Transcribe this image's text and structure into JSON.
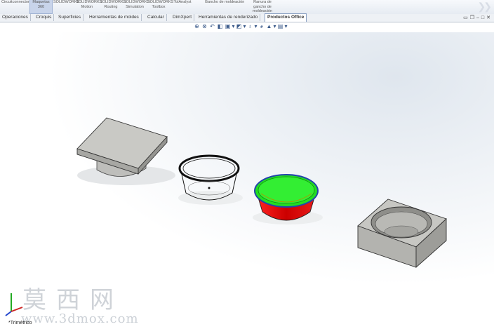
{
  "ribbon": {
    "buttons": [
      {
        "label": "Circuitconnectors"
      },
      {
        "label": "Maquetas\n360"
      },
      {
        "label": "SOLIDWORKS"
      },
      {
        "label": "SOLIDWORKS\nMotion"
      },
      {
        "label": "SOLIDWORKS\nRouting"
      },
      {
        "label": "SOLIDWORKS\nSimulation"
      },
      {
        "label": "SOLIDWORKS\nToolbox"
      },
      {
        "label": "TolAnalyst"
      },
      {
        "label": "Gancho de moldeación"
      },
      {
        "label": "Ranura de\ngancho de\nmoldeación"
      }
    ]
  },
  "tabs": [
    {
      "label": "Operaciones"
    },
    {
      "label": "Croquis"
    },
    {
      "label": "Superficies"
    },
    {
      "label": "Herramientas de moldes"
    },
    {
      "label": "Calcular"
    },
    {
      "label": "DimXpert"
    },
    {
      "label": "Herramientas de renderizado"
    },
    {
      "label": "Productos Office"
    }
  ],
  "viewport": {
    "view_label": "*Trimétrico"
  },
  "watermark": {
    "chinese": "莫西网",
    "url": "www.3dmox.com"
  },
  "taskpane_icons": [
    "resources-icon",
    "design-library-icon",
    "file-explorer-icon",
    "view-palette-icon",
    "appearances-icon",
    "custom-properties-icon"
  ],
  "colors": {
    "cavity_green": "#22dd22",
    "core_red": "#dd1111",
    "part_gray": "#c8c8c4"
  }
}
